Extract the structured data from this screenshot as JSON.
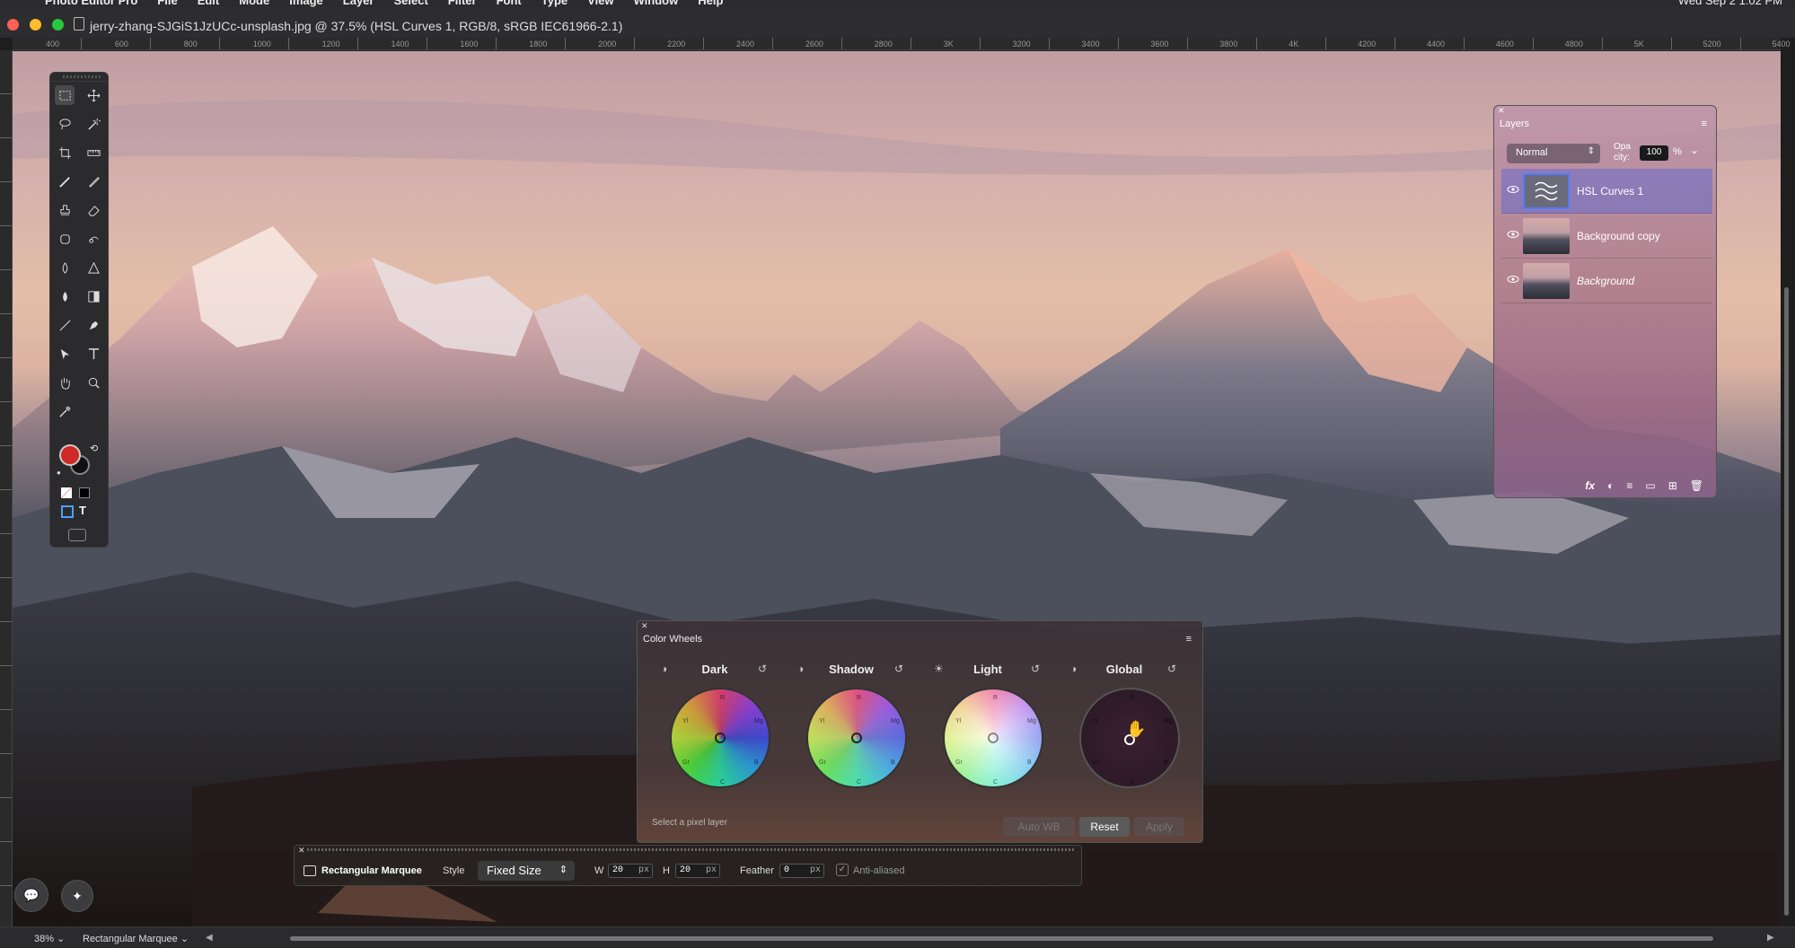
{
  "window": {
    "title": "jerry-zhang-SJGiS1JzUCc-unsplash.jpg @ 37.5% (HSL Curves 1, RGB/8, sRGB IEC61966-2.1)"
  },
  "menubar": {
    "app": "Photo Editor Pro",
    "items": [
      "File",
      "Edit",
      "Mode",
      "Image",
      "Layer",
      "Select",
      "Filter",
      "Font",
      "Type",
      "View",
      "Window",
      "Help"
    ],
    "clock": "Wed Sep 2  1:02 PM"
  },
  "ruler": {
    "ticks": [
      "400",
      "600",
      "800",
      "1000",
      "1200",
      "1400",
      "1600",
      "1800",
      "2000",
      "2200",
      "2400",
      "2600",
      "2800",
      "3K",
      "3200",
      "3400",
      "3600",
      "3800",
      "4K",
      "4200",
      "4400",
      "4600",
      "4800",
      "5K",
      "5200",
      "5400"
    ]
  },
  "tools": {
    "icons": [
      "rect-marquee-icon",
      "move-icon",
      "lasso-icon",
      "magic-wand-icon",
      "crop-icon",
      "ruler-icon",
      "brush-icon",
      "pencil-icon",
      "stamp-icon",
      "eraser-icon",
      "patch-icon",
      "smudge-icon",
      "dodge-icon",
      "triangle-icon",
      "drop-icon",
      "gradient-icon",
      "line-icon",
      "pen-icon",
      "select-arrow-icon",
      "type-icon",
      "hand-icon",
      "zoom-icon",
      "eyedropper-icon"
    ],
    "foreground_color": "#d02a28",
    "background_color": "#111111"
  },
  "layers": {
    "title": "Layers",
    "blend_mode": "Normal",
    "opacity_label": "Opa city:",
    "opacity": "100",
    "opacity_unit": "%",
    "items": [
      {
        "name": "HSL Curves 1",
        "selected": true
      },
      {
        "name": "Background copy",
        "selected": false
      },
      {
        "name": "Background",
        "selected": false
      }
    ],
    "footer": [
      "fx",
      "◐",
      "≡",
      "▭",
      "⊞",
      "🗑"
    ]
  },
  "color_wheels": {
    "title": "Color Wheels",
    "wheels": [
      {
        "label": "Dark"
      },
      {
        "label": "Shadow"
      },
      {
        "label": "Light"
      },
      {
        "label": "Global"
      }
    ],
    "wheel_letters": [
      "Yl",
      "R",
      "Mg",
      "Gr",
      "B",
      "C"
    ],
    "status": "Select a pixel layer",
    "buttons": {
      "auto_wb": "Auto WB",
      "reset": "Reset",
      "apply": "Apply"
    }
  },
  "options_bar": {
    "tool_name": "Rectangular Marquee",
    "style_label": "Style",
    "style_value": "Fixed Size",
    "w_label": "W",
    "w_value": "20",
    "h_label": "H",
    "h_value": "20",
    "unit": "px",
    "feather_label": "Feather",
    "feather_value": "0",
    "antialias_label": "Anti-aliased"
  },
  "statusbar": {
    "zoom": "38%",
    "tool": "Rectangular Marquee"
  }
}
